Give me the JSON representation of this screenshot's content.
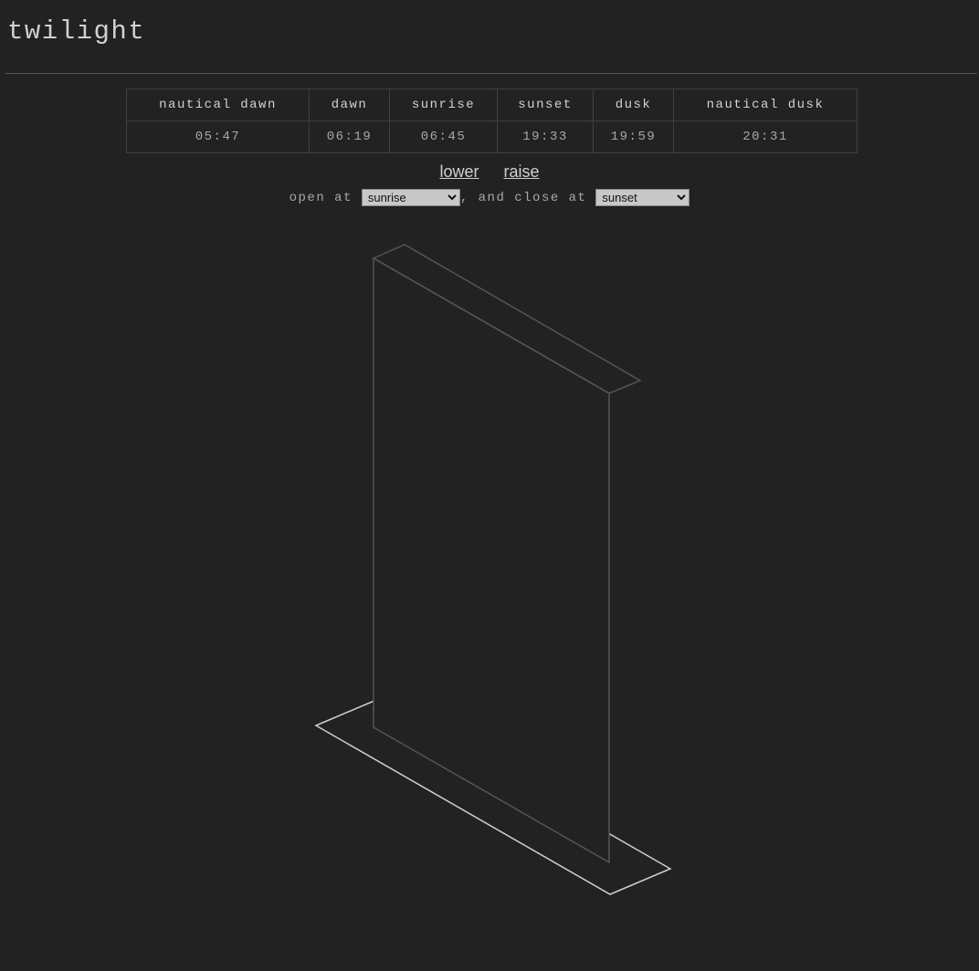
{
  "app": {
    "title": "twilight"
  },
  "times_table": {
    "headers": [
      "nautical dawn",
      "dawn",
      "sunrise",
      "sunset",
      "dusk",
      "nautical dusk"
    ],
    "values": [
      "05:47",
      "06:19",
      "06:45",
      "19:33",
      "19:59",
      "20:31"
    ]
  },
  "controls": {
    "lower_label": "lower",
    "raise_label": "raise"
  },
  "schedule": {
    "open_prefix": "open at",
    "open_value": "sunrise",
    "mid_text": ", and close at",
    "close_value": "sunset",
    "options": [
      "nautical dawn",
      "dawn",
      "sunrise",
      "sunset",
      "dusk",
      "nautical dusk"
    ]
  },
  "colors": {
    "background": "#222222",
    "blind_stroke": "#555555",
    "base_stroke": "#d0d0d0"
  },
  "blind_state": {
    "position": "raised"
  }
}
